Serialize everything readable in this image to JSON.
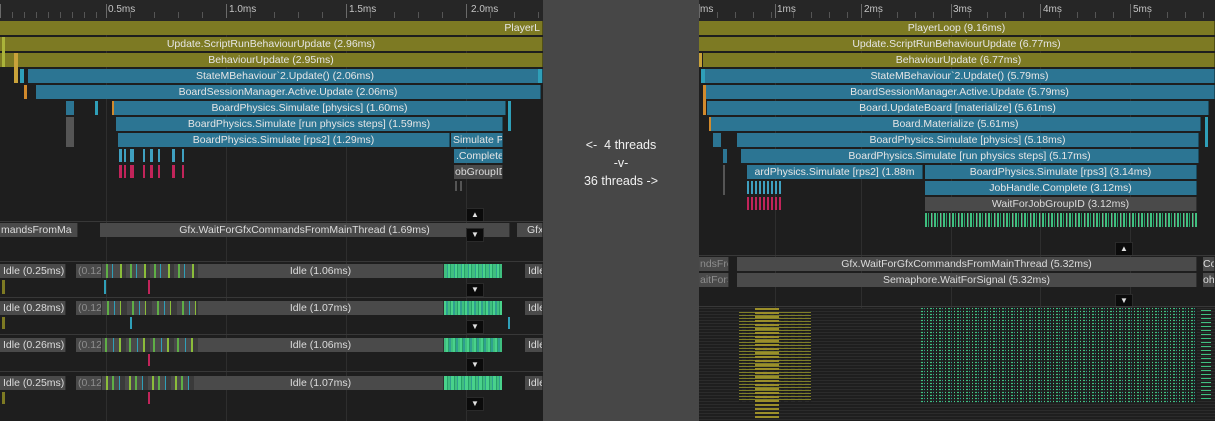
{
  "comparison": {
    "line1": "<-  4 threads",
    "line2": "-v-",
    "line3": "36 threads ->"
  },
  "left": {
    "ruler_labels": [
      "0.5ms",
      "1.0ms",
      "1.5ms",
      "2.0ms"
    ],
    "main_thread": {
      "player_loop": "PlayerL",
      "update_script": "Update.ScriptRunBehaviourUpdate (2.96ms)",
      "behaviour_update": "BehaviourUpdate (2.95ms)",
      "state_mb_update": "StateMBehaviour`2.Update() (2.06ms)",
      "board_session_update": "BoardSessionManager.Active.Update (2.06ms)",
      "board_physics_simulate": "BoardPhysics.Simulate [physics] (1.60ms)",
      "board_physics_steps": "BoardPhysics.Simulate [run physics steps] (1.59ms)",
      "board_physics_rps2": "BoardPhysics.Simulate [rps2] (1.29ms)",
      "simulate_fragment": "Simulate P",
      "complete_fragment": ".Complete",
      "jobgroup_fragment": "obGroupID"
    },
    "render_thread": {
      "left_fragment": "mandsFromMa",
      "wait_gfx": "Gfx.WaitForGfxCommandsFromMainThread (1.69ms)",
      "right_fragment": "Gfx"
    },
    "workers": [
      {
        "idle_a": "Idle (0.25ms)",
        "idle_b": "(0.12",
        "idle_c": "Idle (1.06ms)",
        "idle_d": "Idle"
      },
      {
        "idle_a": "Idle (0.28ms)",
        "idle_b": "(0.12",
        "idle_c": "Idle (1.07ms)",
        "idle_d": "Idle"
      },
      {
        "idle_a": "Idle (0.26ms)",
        "idle_b": "(0.12",
        "idle_c": "Idle (1.06ms)",
        "idle_d": "Idle"
      },
      {
        "idle_a": "Idle (0.25ms)",
        "idle_b": "(0.12",
        "idle_c": "Idle (1.07ms)",
        "idle_d": "Idle"
      }
    ]
  },
  "right": {
    "ruler_labels": [
      "ms",
      "1ms",
      "2ms",
      "3ms",
      "4ms",
      "5ms"
    ],
    "main_thread": {
      "player_loop": "PlayerLoop (9.16ms)",
      "update_script": "Update.ScriptRunBehaviourUpdate (6.77ms)",
      "behaviour_update": "BehaviourUpdate (6.77ms)",
      "state_mb_update": "StateMBehaviour`2.Update() (5.79ms)",
      "board_session_update": "BoardSessionManager.Active.Update (5.79ms)",
      "update_board": "Board.UpdateBoard [materialize] (5.61ms)",
      "materialize": "Board.Materialize (5.61ms)",
      "board_physics_simulate": "BoardPhysics.Simulate [physics] (5.18ms)",
      "board_physics_steps": "BoardPhysics.Simulate [run physics steps] (5.17ms)",
      "board_physics_rps2": "ardPhysics.Simulate [rps2] (1.88m",
      "board_physics_rps3": "BoardPhysics.Simulate [rps3] (3.14ms)",
      "jobhandle_complete": "JobHandle.Complete (3.12ms)",
      "wait_jobgroup": "WaitForJobGroupID (3.12ms)"
    },
    "render_thread": {
      "left_fragment_1": "ndsFro",
      "left_fragment_2": "aitForSi",
      "wait_gfx": "Gfx.WaitForGfxCommandsFromMainThread (5.32ms)",
      "wait_signal": "Semaphore.WaitForSignal (5.32ms)",
      "right_fragment_1": "Co",
      "right_fragment_2": "oh"
    }
  },
  "colors": {
    "olive": "#7d7a23",
    "blue": "#2c7593",
    "idle_grey": "#4a4a4a",
    "job_green": "#3fbf7f",
    "job_pink": "#c2245a"
  }
}
